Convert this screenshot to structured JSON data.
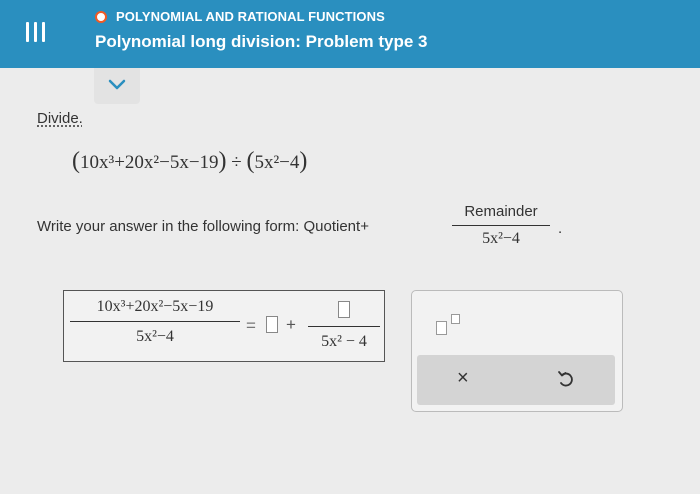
{
  "header": {
    "topic": "POLYNOMIAL AND RATIONAL FUNCTIONS",
    "title": "Polynomial long division: Problem type 3",
    "menu_icon": "menu-icon",
    "bg_color": "#2a8fbf",
    "status_dot_color": "#f15a24"
  },
  "collapse_icon": "chevron-down-icon",
  "problem": {
    "instruction_label": "Divide.",
    "dividend": "10x³+20x²−5x−19",
    "divisor": "5x²−4",
    "answer_prompt": "Write your answer in the following form: Quotient",
    "plus_sign": "+",
    "remainder_label": "Remainder",
    "end_period": "."
  },
  "answer": {
    "numerator": "10x³+20x²−5x−19",
    "denominator": "5x²−4",
    "equals": "=",
    "plus": "+",
    "remainder_denominator": "5x² − 4"
  },
  "keypad": {
    "fraction_icon": "fraction-template-icon",
    "clear_label": "×",
    "undo_icon": "undo-icon"
  }
}
